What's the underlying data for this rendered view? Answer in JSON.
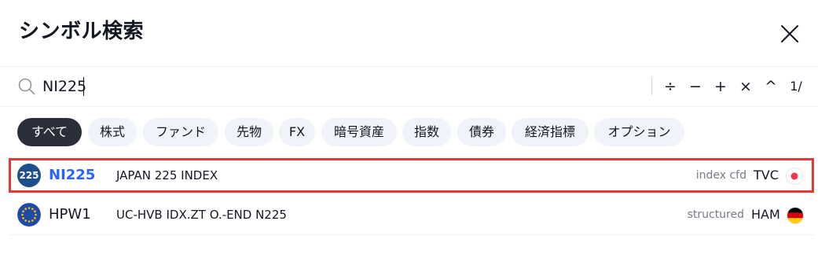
{
  "dialog": {
    "title": "シンボル検索"
  },
  "search": {
    "value": "NI225",
    "operators": [
      "÷",
      "−",
      "+",
      "×",
      "^",
      "1/"
    ]
  },
  "filters": [
    {
      "label": "すべて",
      "active": true
    },
    {
      "label": "株式"
    },
    {
      "label": "ファンド"
    },
    {
      "label": "先物"
    },
    {
      "label": "FX"
    },
    {
      "label": "暗号資産"
    },
    {
      "label": "指数"
    },
    {
      "label": "債券"
    },
    {
      "label": "経済指標"
    },
    {
      "label": "オプション"
    }
  ],
  "results": [
    {
      "logo_text": "225",
      "symbol": "NI225",
      "description": "JAPAN 225 INDEX",
      "type": "index cfd",
      "exchange": "TVC",
      "exchange_icon": "red-dot-icon",
      "highlighted": true
    },
    {
      "logo_icon": "eu-flag-icon",
      "symbol": "HPW1",
      "description": "UC-HVB IDX.ZT O.-END N225",
      "type": "structured",
      "exchange": "HAM",
      "exchange_icon": "germany-flag-icon"
    }
  ],
  "colors": {
    "accent": "#2962ff",
    "highlight_border": "#e53935",
    "active_chip": "#2a2e39",
    "chip": "#f0f3fa"
  }
}
